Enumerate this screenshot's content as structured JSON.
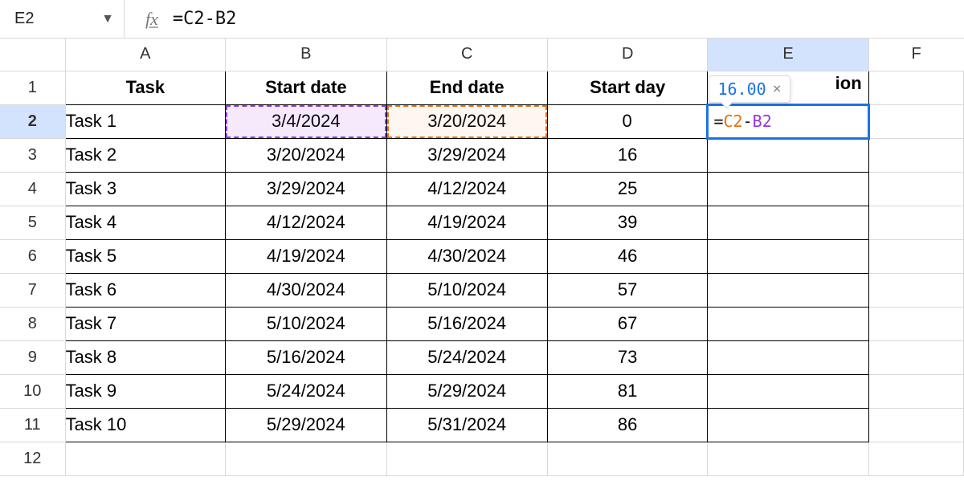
{
  "formula_bar": {
    "cell_ref": "E2",
    "fx_label": "fx",
    "formula_text": "=C2-B2"
  },
  "columns": [
    "A",
    "B",
    "C",
    "D",
    "E",
    "F"
  ],
  "selected_column": "E",
  "selected_row": "2",
  "row_numbers": [
    "1",
    "2",
    "3",
    "4",
    "5",
    "6",
    "7",
    "8",
    "9",
    "10",
    "11",
    "12"
  ],
  "headers": {
    "A": "Task",
    "B": "Start date",
    "C": "End date",
    "D": "Start day",
    "E_visible_fragment": "ion"
  },
  "rows": [
    {
      "A": "Task 1",
      "B": "3/4/2024",
      "C": "3/20/2024",
      "D": "0"
    },
    {
      "A": "Task 2",
      "B": "3/20/2024",
      "C": "3/29/2024",
      "D": "16"
    },
    {
      "A": "Task 3",
      "B": "3/29/2024",
      "C": "4/12/2024",
      "D": "25"
    },
    {
      "A": "Task 4",
      "B": "4/12/2024",
      "C": "4/19/2024",
      "D": "39"
    },
    {
      "A": "Task 5",
      "B": "4/19/2024",
      "C": "4/30/2024",
      "D": "46"
    },
    {
      "A": "Task 6",
      "B": "4/30/2024",
      "C": "5/10/2024",
      "D": "57"
    },
    {
      "A": "Task 7",
      "B": "5/10/2024",
      "C": "5/16/2024",
      "D": "67"
    },
    {
      "A": "Task 8",
      "B": "5/16/2024",
      "C": "5/24/2024",
      "D": "73"
    },
    {
      "A": "Task 9",
      "B": "5/24/2024",
      "C": "5/29/2024",
      "D": "81"
    },
    {
      "A": "Task 10",
      "B": "5/29/2024",
      "C": "5/31/2024",
      "D": "86"
    }
  ],
  "editing": {
    "tokens": {
      "eq": "=",
      "c2": "C2",
      "op": "-",
      "b2": "B2"
    },
    "preview_result": "16.00",
    "close_symbol": "×"
  },
  "ref_highlights": {
    "B2": "purple",
    "C2": "orange"
  }
}
